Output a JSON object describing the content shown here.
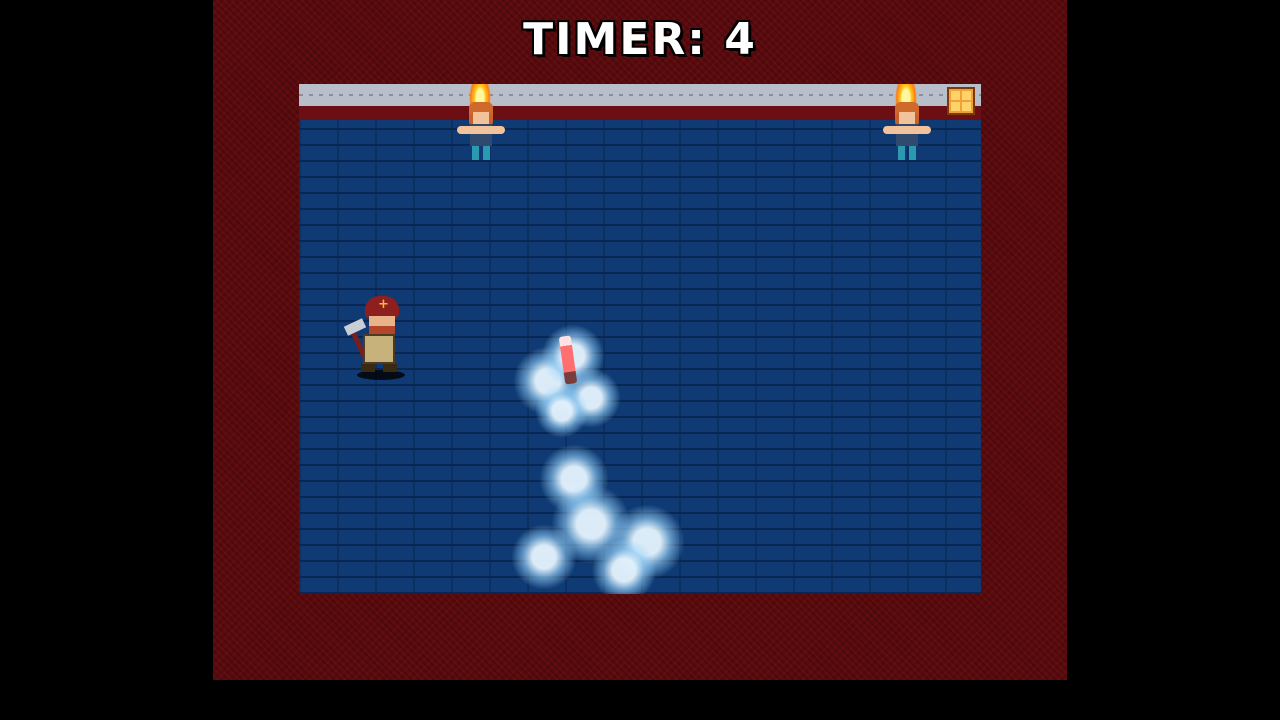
{
  "hud": {
    "timer_label": "TIMER: 4",
    "timer_value": 4
  },
  "scene": {
    "room": "blue-brick-floor",
    "frame": "red-carpet-border",
    "characters": [
      {
        "type": "victim-on-fire",
        "count": 2
      },
      {
        "type": "firefighter-with-axe",
        "count": 1
      }
    ],
    "effects": [
      "smoke-cloud",
      "extinguisher-spray"
    ]
  },
  "colors": {
    "frame": "#5a0b0e",
    "floor": "#0f3a73",
    "timer_text": "#ffffff",
    "flame": "#ffcc22"
  }
}
